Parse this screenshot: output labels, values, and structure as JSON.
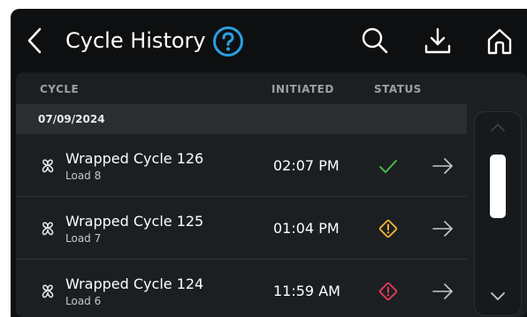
{
  "header": {
    "title": "Cycle History",
    "icons": {
      "back": "chevron-left-icon",
      "help": "question-circle-icon",
      "search": "search-icon",
      "download": "download-icon",
      "home": "home-icon"
    }
  },
  "colors": {
    "accent": "#2a9fe0",
    "success": "#4cc34c",
    "warning": "#f5b531",
    "error": "#e8395b"
  },
  "table": {
    "columns": [
      "CYCLE",
      "INITIATED",
      "STATUS"
    ],
    "groups": [
      {
        "date": "07/09/2024",
        "rows": [
          {
            "title": "Wrapped Cycle 126",
            "load": "Load 8",
            "initiated": "02:07 PM",
            "status": "success"
          },
          {
            "title": "Wrapped Cycle 125",
            "load": "Load 7",
            "initiated": "01:04 PM",
            "status": "warning"
          },
          {
            "title": "Wrapped Cycle 124",
            "load": "Load 6",
            "initiated": "11:59 AM",
            "status": "error"
          }
        ]
      }
    ]
  },
  "scrollbar": {
    "up_icon": "chevron-up-icon",
    "down_icon": "chevron-down-icon"
  }
}
